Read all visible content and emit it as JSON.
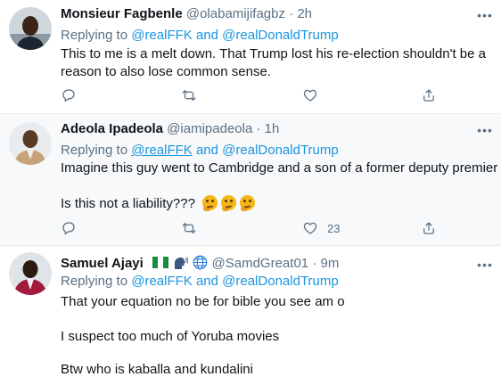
{
  "tweets": [
    {
      "name": "Monsieur Fagbenle",
      "handle": "@olabamijifagbz",
      "dot": "·",
      "time": "2h",
      "replying_to": "Replying to",
      "mention_1": "@realFFK",
      "and": "and",
      "mention_2": "@realDonaldTrump",
      "lines": [
        "This to me is a melt down. That Trump lost his re-election shouldn't be a",
        "reason to also lose common sense."
      ],
      "actions": {
        "reply_count": "",
        "retweet_count": "",
        "like_count": ""
      }
    },
    {
      "name": "Adeola Ipadeola",
      "handle": "@iamipadeola",
      "dot": "·",
      "time": "1h",
      "replying_to": "Replying to",
      "mention_1": "@realFFK",
      "and": "and",
      "mention_2": "@realDonaldTrump",
      "lines": [
        "Imagine this guy went to Cambridge and a son of a former deputy premier",
        "Is this not a liability???"
      ],
      "emoji": [
        "thinking-face",
        "thinking-face",
        "thinking-face"
      ],
      "actions": {
        "reply_count": "",
        "retweet_count": "",
        "like_count": "23"
      }
    },
    {
      "name": "Samuel Ajayi",
      "handle": "@SamdGreat01",
      "dot": "·",
      "time": "9m",
      "name_icons": [
        "nigeria-flag",
        "speaking-head",
        "globe"
      ],
      "replying_to": "Replying to",
      "mention_1": "@realFFK",
      "and": "and",
      "mention_2": "@realDonaldTrump",
      "lines": [
        "That your equation no be for bible you see am o",
        "I suspect too much of Yoruba movies",
        "Btw who is kaballa and kundalini"
      ]
    }
  ],
  "colors": {
    "text": "#0f1419",
    "secondary": "#5b7083",
    "link": "#1b95e0",
    "hover_bg": "#f7f9fa",
    "divider": "#e6ecf0"
  },
  "icons": {
    "more": "more-dots-icon",
    "reply": "reply-icon",
    "retweet": "retweet-icon",
    "like": "heart-icon",
    "share": "share-icon"
  }
}
